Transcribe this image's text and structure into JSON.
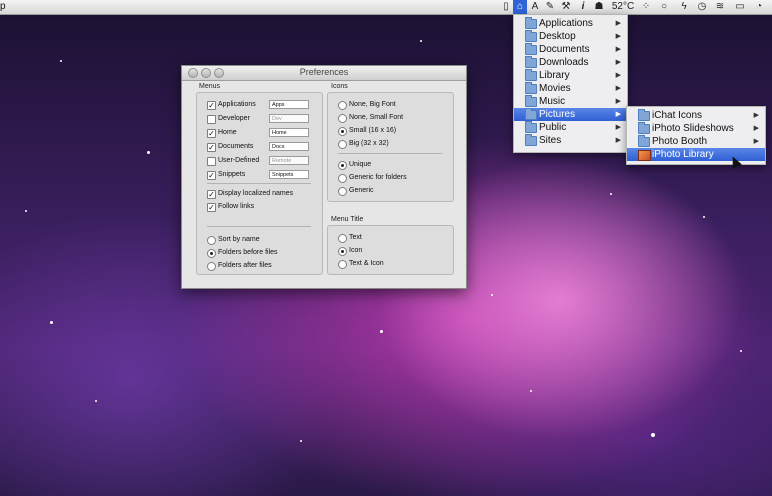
{
  "menubar": {
    "app_fragment": "p",
    "temperature": "52°C",
    "icons": [
      "document-icon",
      "folder-menu-icon",
      "a-app-icon",
      "tools-icon",
      "info-icon",
      "ghost-icon",
      "chat-bubble-icon",
      "lightning-icon",
      "time-machine-icon",
      "wifi-icon",
      "battery-icon",
      "clock-icon"
    ]
  },
  "folders_menu": {
    "items": [
      {
        "label": "Applications",
        "has_submenu": true
      },
      {
        "label": "Desktop",
        "has_submenu": true
      },
      {
        "label": "Documents",
        "has_submenu": true
      },
      {
        "label": "Downloads",
        "has_submenu": true
      },
      {
        "label": "Library",
        "has_submenu": true
      },
      {
        "label": "Movies",
        "has_submenu": true
      },
      {
        "label": "Music",
        "has_submenu": true
      },
      {
        "label": "Pictures",
        "has_submenu": true,
        "selected": true
      },
      {
        "label": "Public",
        "has_submenu": true
      },
      {
        "label": "Sites",
        "has_submenu": true
      }
    ]
  },
  "pictures_submenu": {
    "items": [
      {
        "label": "iChat Icons",
        "has_submenu": true
      },
      {
        "label": "iPhoto Slideshows",
        "has_submenu": true
      },
      {
        "label": "Photo Booth",
        "has_submenu": true
      },
      {
        "label": "iPhoto Library",
        "has_submenu": false,
        "selected": true
      }
    ]
  },
  "preferences": {
    "title": "Preferences",
    "menus": {
      "label": "Menus",
      "items": [
        {
          "label": "Applications",
          "checked": true,
          "field": "Apps",
          "enabled": true
        },
        {
          "label": "Developer",
          "checked": false,
          "field": "Dev",
          "enabled": false
        },
        {
          "label": "Home",
          "checked": true,
          "field": "Home",
          "enabled": true
        },
        {
          "label": "Documents",
          "checked": true,
          "field": "Docs",
          "enabled": true
        },
        {
          "label": "User-Defined",
          "checked": false,
          "field": "Remote",
          "enabled": false
        },
        {
          "label": "Snippets",
          "checked": true,
          "field": "Snippets",
          "enabled": true
        }
      ],
      "options": [
        {
          "label": "Display localized names",
          "checked": true
        },
        {
          "label": "Follow links",
          "checked": true
        }
      ],
      "sort": [
        {
          "label": "Sort by name",
          "selected": false
        },
        {
          "label": "Folders before files",
          "selected": true
        },
        {
          "label": "Folders after files",
          "selected": false
        }
      ]
    },
    "icons": {
      "label": "Icons",
      "size_options": [
        {
          "label": "None, Big Font",
          "selected": false
        },
        {
          "label": "None, Small Font",
          "selected": false
        },
        {
          "label": "Small (16 x 16)",
          "selected": true
        },
        {
          "label": "Big (32 x 32)",
          "selected": false
        }
      ],
      "style_options": [
        {
          "label": "Unique",
          "selected": true
        },
        {
          "label": "Generic for folders",
          "selected": false
        },
        {
          "label": "Generic",
          "selected": false
        }
      ]
    },
    "menu_title": {
      "label": "Menu Title",
      "options": [
        {
          "label": "Text",
          "selected": false
        },
        {
          "label": "Icon",
          "selected": true
        },
        {
          "label": "Text & Icon",
          "selected": false
        }
      ]
    }
  }
}
